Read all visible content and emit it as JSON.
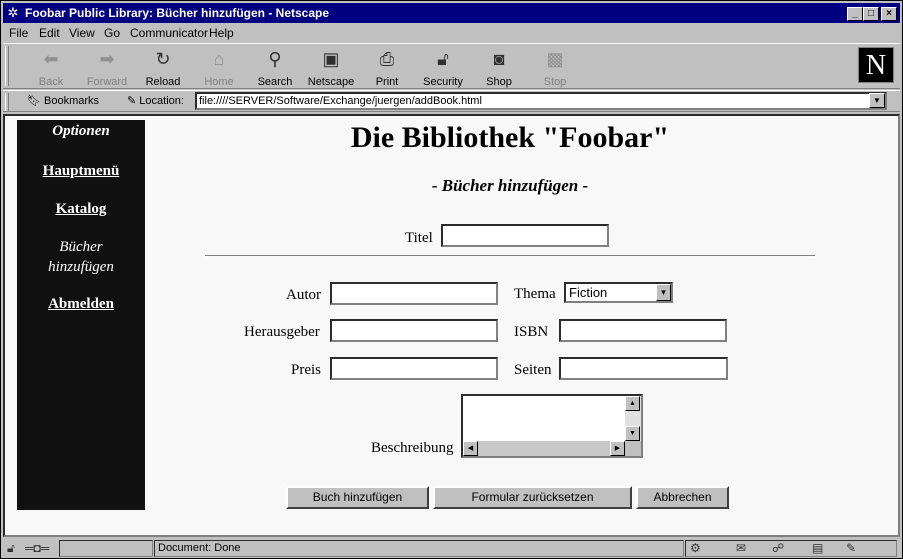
{
  "window": {
    "title": "Foobar Public Library: Bücher hinzufügen - Netscape"
  },
  "menu": [
    "File",
    "Edit",
    "View",
    "Go",
    "Communicator",
    "Help"
  ],
  "toolbar": {
    "back": "Back",
    "forward": "Forward",
    "reload": "Reload",
    "home": "Home",
    "search": "Search",
    "netscape": "Netscape",
    "print": "Print",
    "security": "Security",
    "shop": "Shop",
    "stop": "Stop"
  },
  "location": {
    "bookmarks": "Bookmarks",
    "label": "Location:",
    "url": "file:////SERVER/Software/Exchange/juergen/addBook.html"
  },
  "sidebar": {
    "heading": "Optionen",
    "hauptmenu": "Hauptmenü",
    "katalog": "Katalog",
    "current_line1": "Bücher",
    "current_line2": "hinzufügen",
    "abmelden": "Abmelden"
  },
  "page": {
    "title": "Die Bibliothek \"Foobar\"",
    "subtitle": "- Bücher hinzufügen -"
  },
  "form": {
    "titel_label": "Titel",
    "autor_label": "Autor",
    "thema_label": "Thema",
    "thema_value": "Fiction",
    "herausgeber_label": "Herausgeber",
    "isbn_label": "ISBN",
    "preis_label": "Preis",
    "seiten_label": "Seiten",
    "beschreibung_label": "Beschreibung"
  },
  "buttons": {
    "add": "Buch hinzufügen",
    "reset": "Formular zurücksetzen",
    "cancel": "Abbrechen"
  },
  "status": {
    "text": "Document: Done"
  }
}
